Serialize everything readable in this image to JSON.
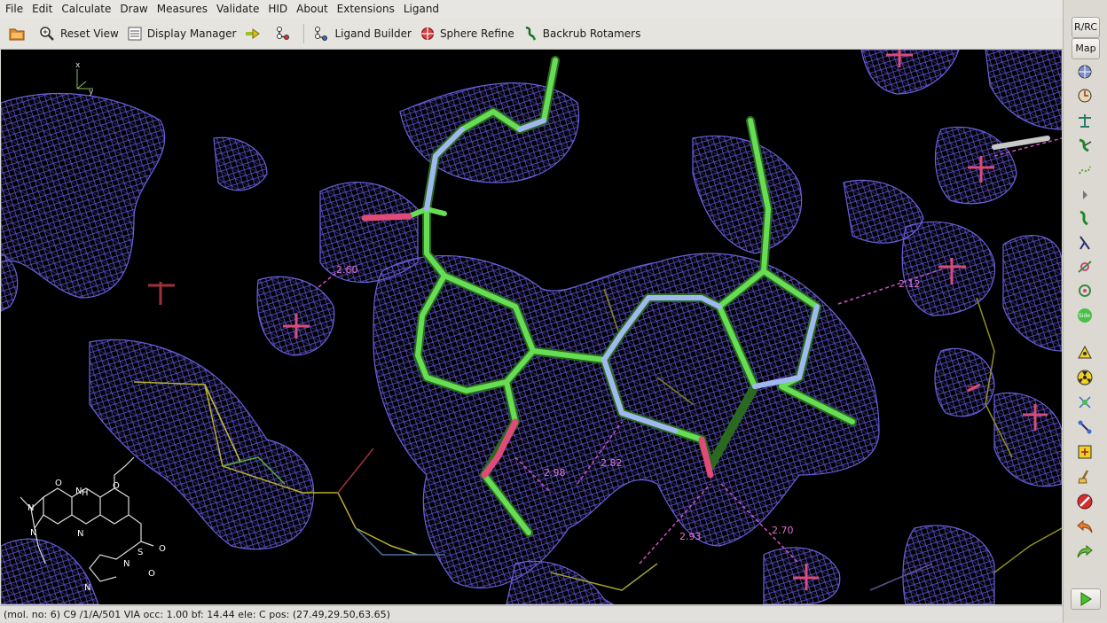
{
  "menu": [
    "File",
    "Edit",
    "Calculate",
    "Draw",
    "Measures",
    "Validate",
    "HID",
    "About",
    "Extensions",
    "Ligand"
  ],
  "toolbar": {
    "reset_view": "Reset View",
    "display_manager": "Display Manager",
    "ligand_builder": "Ligand Builder",
    "sphere_refine": "Sphere Refine",
    "backrub_rotamers": "Backrub Rotamers"
  },
  "side": {
    "rrc": "R/RC",
    "map": "Map"
  },
  "viewport": {
    "axis_x": "x",
    "axis_y": "y",
    "distances": [
      "2.60",
      "2.12",
      "2.98",
      "2.82",
      "2.93",
      "2.70"
    ],
    "sketch_labels": [
      "O",
      "H",
      "N",
      "N",
      "N",
      "N",
      "N",
      "N",
      "S",
      "O",
      "O",
      "O"
    ]
  },
  "status": "(mol. no: 6)  C9 /1/A/501 VIA occ:  1.00 bf: 14.44 ele:  C pos: (27.49,29.50,63.65)",
  "colors": {
    "mesh": "#5a50c8",
    "carbon": "#66dd55",
    "nitrogen": "#a0b8f0",
    "oxygen": "#e04a78",
    "water": "#d84c7c",
    "distance": "#e070d0"
  }
}
